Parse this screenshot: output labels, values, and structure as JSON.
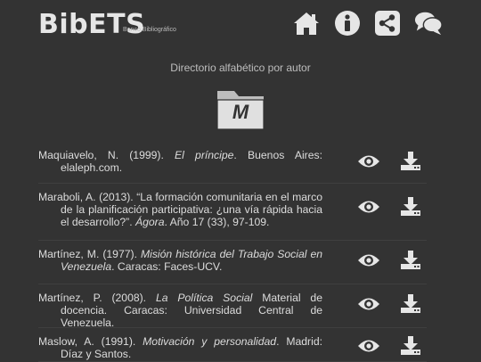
{
  "header": {
    "logo": "BibETS",
    "logo_sub": "Banco Bibliográfico",
    "nav": [
      "home-icon",
      "info-icon",
      "share-icon",
      "chat-icon"
    ]
  },
  "page_title": "Directorio alfabético por autor",
  "letter": "M",
  "entries": [
    {
      "pre": "Maquiavelo, N. (1999). ",
      "title": "El príncipe",
      "post": ". Buenos Aires: elaleph.com."
    },
    {
      "pre": "Maraboli, A. (2013). “La formación comunitaria en el marco de la planificación participativa: ¿una vía rápida hacia el desarrollo?”. ",
      "title": "Ágora",
      "post": ". Año 17 (33), 97-109."
    },
    {
      "pre": "Martínez, M. (1977). ",
      "title": "Misión histórica del Trabajo Social en Venezuela",
      "post": ". Caracas: Faces-UCV."
    },
    {
      "pre": "Martínez, P. (2008). ",
      "title": "La Política Social",
      "post": " Material de docencia. Caracas: Universidad Central de Venezuela."
    },
    {
      "pre": "Maslow, A. (1991). ",
      "title": "Motivación y personalidad",
      "post": ". Madrid: Díaz y Santos."
    }
  ],
  "colors": {
    "background": "#333333",
    "icon": "#e6e6e6",
    "text": "#dcdcdc"
  }
}
